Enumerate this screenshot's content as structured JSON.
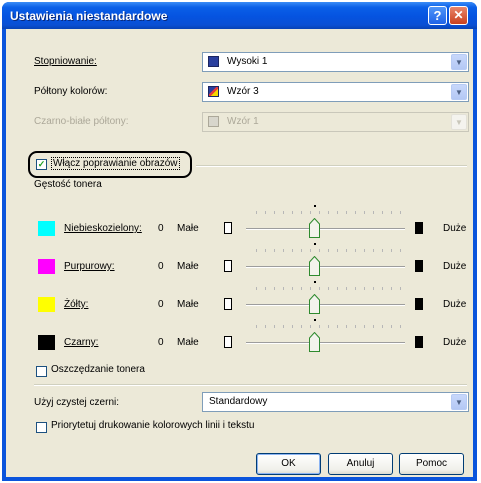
{
  "window": {
    "title": "Ustawienia niestandardowe"
  },
  "gradation": {
    "label": "Stopniowanie:",
    "value": "Wysoki 1"
  },
  "color_halftones": {
    "label": "Półtony kolorów:",
    "value": "Wzór 3"
  },
  "bw_halftones": {
    "label": "Czarno-białe półtony:",
    "value": "Wzór 1"
  },
  "image_refinement": {
    "label": "Włącz poprawianie obrazów",
    "checked": true
  },
  "toner_density": {
    "group_label": "Gęstość tonera",
    "scale_min": "Małe",
    "scale_max": "Duże",
    "rows": [
      {
        "name": "Niebieskozielony:",
        "value": "0",
        "color": "#00ffff"
      },
      {
        "name": "Purpurowy:",
        "value": "0",
        "color": "#ff00ff"
      },
      {
        "name": "Żółty:",
        "value": "0",
        "color": "#ffff00"
      },
      {
        "name": "Czarny:",
        "value": "0",
        "color": "#000000"
      }
    ]
  },
  "toner_saving": {
    "label": "Oszczędzanie tonera",
    "checked": false
  },
  "pure_black": {
    "label": "Użyj czystej czerni:",
    "value": "Standardowy"
  },
  "priority_lines": {
    "label": "Priorytetuj drukowanie kolorowych linii i tekstu",
    "checked": false
  },
  "buttons": {
    "ok": "OK",
    "cancel": "Anuluj",
    "help": "Pomoc"
  },
  "colors": {
    "titlebar": "#0553e0",
    "client": "#ece9d8",
    "accent_check": "#21a121"
  }
}
